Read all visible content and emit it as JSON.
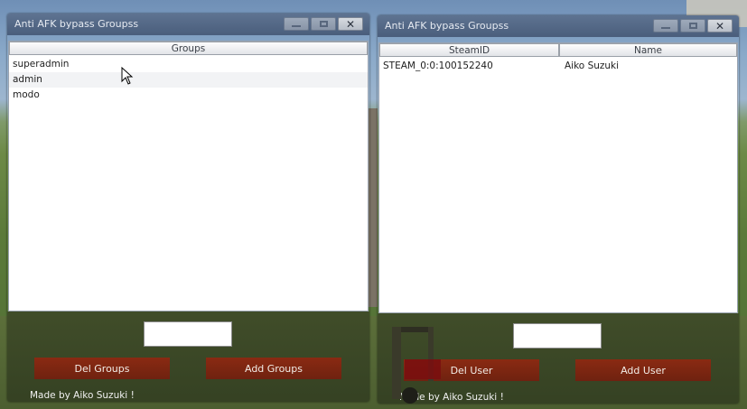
{
  "window_left": {
    "title": "Anti AFK bypass Groupss",
    "column_header": "Groups",
    "rows": [
      "superadmin",
      "admin",
      "modo"
    ],
    "input_value": "",
    "del_button": "Del Groups",
    "add_button": "Add Groups",
    "credit": "Made by Aiko Suzuki !"
  },
  "window_right": {
    "title": "Anti AFK bypass Groupss",
    "columns": [
      "SteamID",
      "Name"
    ],
    "rows": [
      {
        "steamid": "STEAM_0:0:100152240",
        "name": "Aiko Suzuki"
      }
    ],
    "input_value": "",
    "del_button": "Del User",
    "add_button": "Add User",
    "credit": "Made by Aiko Suzuki !"
  },
  "icons": {
    "minimize": "minimize-icon",
    "maximize": "maximize-icon",
    "close": "close-icon",
    "cursor": "mouse-cursor-icon"
  }
}
